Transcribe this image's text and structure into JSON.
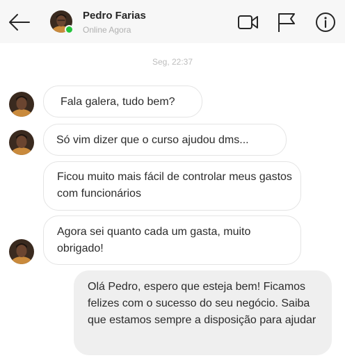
{
  "header": {
    "contact_name": "Pedro Farias",
    "status": "Online Agora",
    "icons": [
      "back-arrow-icon",
      "video-call-icon",
      "flag-icon",
      "info-icon"
    ],
    "online_color": "#22c33b"
  },
  "conversation": {
    "timestamp": "Seg, 22:37",
    "messages": [
      {
        "from": "contact",
        "text": "Fala galera, tudo bem?"
      },
      {
        "from": "contact",
        "text": "Só vim dizer que o curso ajudou dms..."
      },
      {
        "from": "contact",
        "text": "Ficou muito mais fácil de controlar meus gastos com funcionários"
      },
      {
        "from": "contact",
        "text": "Agora sei quanto cada um gasta, muito obrigado!"
      },
      {
        "from": "me",
        "text": "Olá Pedro, espero que esteja bem! Ficamos felizes com o sucesso do seu negócio. Saiba que estamos sempre a disposição para ajudar"
      }
    ]
  }
}
